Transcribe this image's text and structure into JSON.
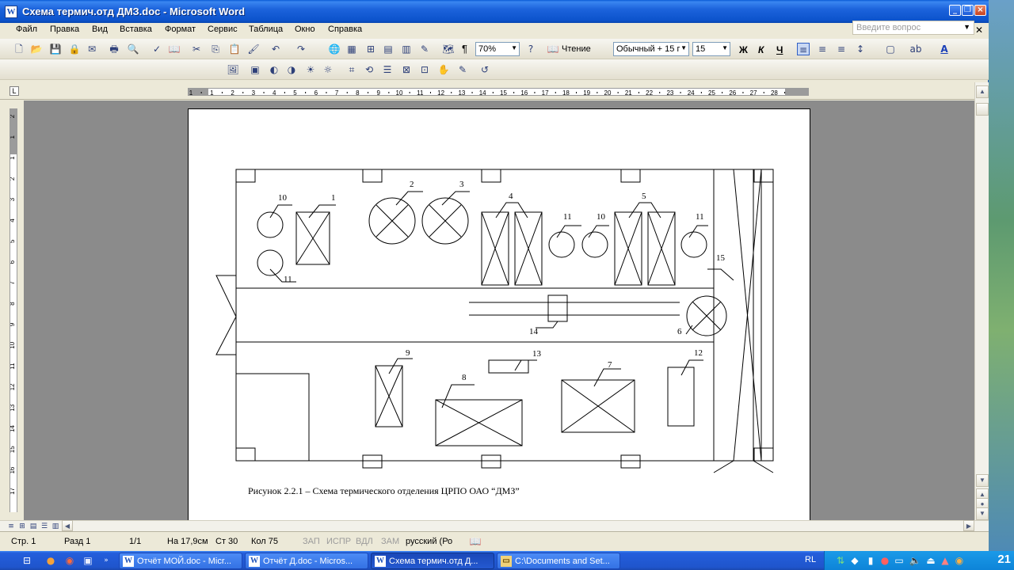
{
  "window": {
    "title": "Схема термич.отд ДМЗ.doc - Microsoft Word",
    "app_icon": "W"
  },
  "menu": [
    "Файл",
    "Правка",
    "Вид",
    "Вставка",
    "Формат",
    "Сервис",
    "Таблица",
    "Окно",
    "Справка"
  ],
  "help_box": {
    "placeholder": "Введите вопрос"
  },
  "toolbar": {
    "zoom": "70%",
    "reading": "Чтение",
    "style": "Обычный + 15 г",
    "size": "15",
    "bold": "Ж",
    "italic": "К",
    "underline": "Ч",
    "pilcrow": "¶"
  },
  "ruler": {
    "labels": [
      "1",
      "1",
      "2",
      "3",
      "4",
      "5",
      "6",
      "7",
      "8",
      "9",
      "10",
      "11",
      "12",
      "13",
      "14",
      "15",
      "16",
      "17",
      "18",
      "19",
      "20",
      "21",
      "22",
      "23",
      "24",
      "25",
      "26",
      "27",
      "28"
    ]
  },
  "ruler_v": {
    "labels": [
      "2",
      "1",
      "1",
      "2",
      "3",
      "4",
      "5",
      "6",
      "7",
      "8",
      "9",
      "10",
      "11",
      "12",
      "13",
      "14",
      "15",
      "16",
      "17"
    ]
  },
  "drawing": {
    "caption": "Рисунок 2.2.1 – Схема термического отделения ЦРПО  ОАО “ДМЗ”",
    "labels": [
      "10",
      "1",
      "2",
      "3",
      "4",
      "11",
      "10",
      "5",
      "11",
      "11",
      "15",
      "14",
      "6",
      "9",
      "13",
      "7",
      "12",
      "8"
    ]
  },
  "status": {
    "page": "Стр. 1",
    "section": "Разд 1",
    "pages": "1/1",
    "at": "На 17,9см",
    "line": "Ст 30",
    "col": "Кол 75",
    "rec": "ЗАП",
    "trk": "ИСПР",
    "ext": "ВДЛ",
    "ovr": "ЗАМ",
    "lang": "русский (Ро"
  },
  "taskbar": {
    "tasks": [
      {
        "label": "Отчёт МОЙ.doc - Micr...",
        "icon": "W"
      },
      {
        "label": "Отчёт Д.doc - Micros...",
        "icon": "W"
      },
      {
        "label": "Схема термич.отд Д...",
        "icon": "W"
      },
      {
        "label": "C:\\Documents and Set...",
        "icon": "▭"
      }
    ],
    "lang": "RL",
    "clock": "21"
  }
}
